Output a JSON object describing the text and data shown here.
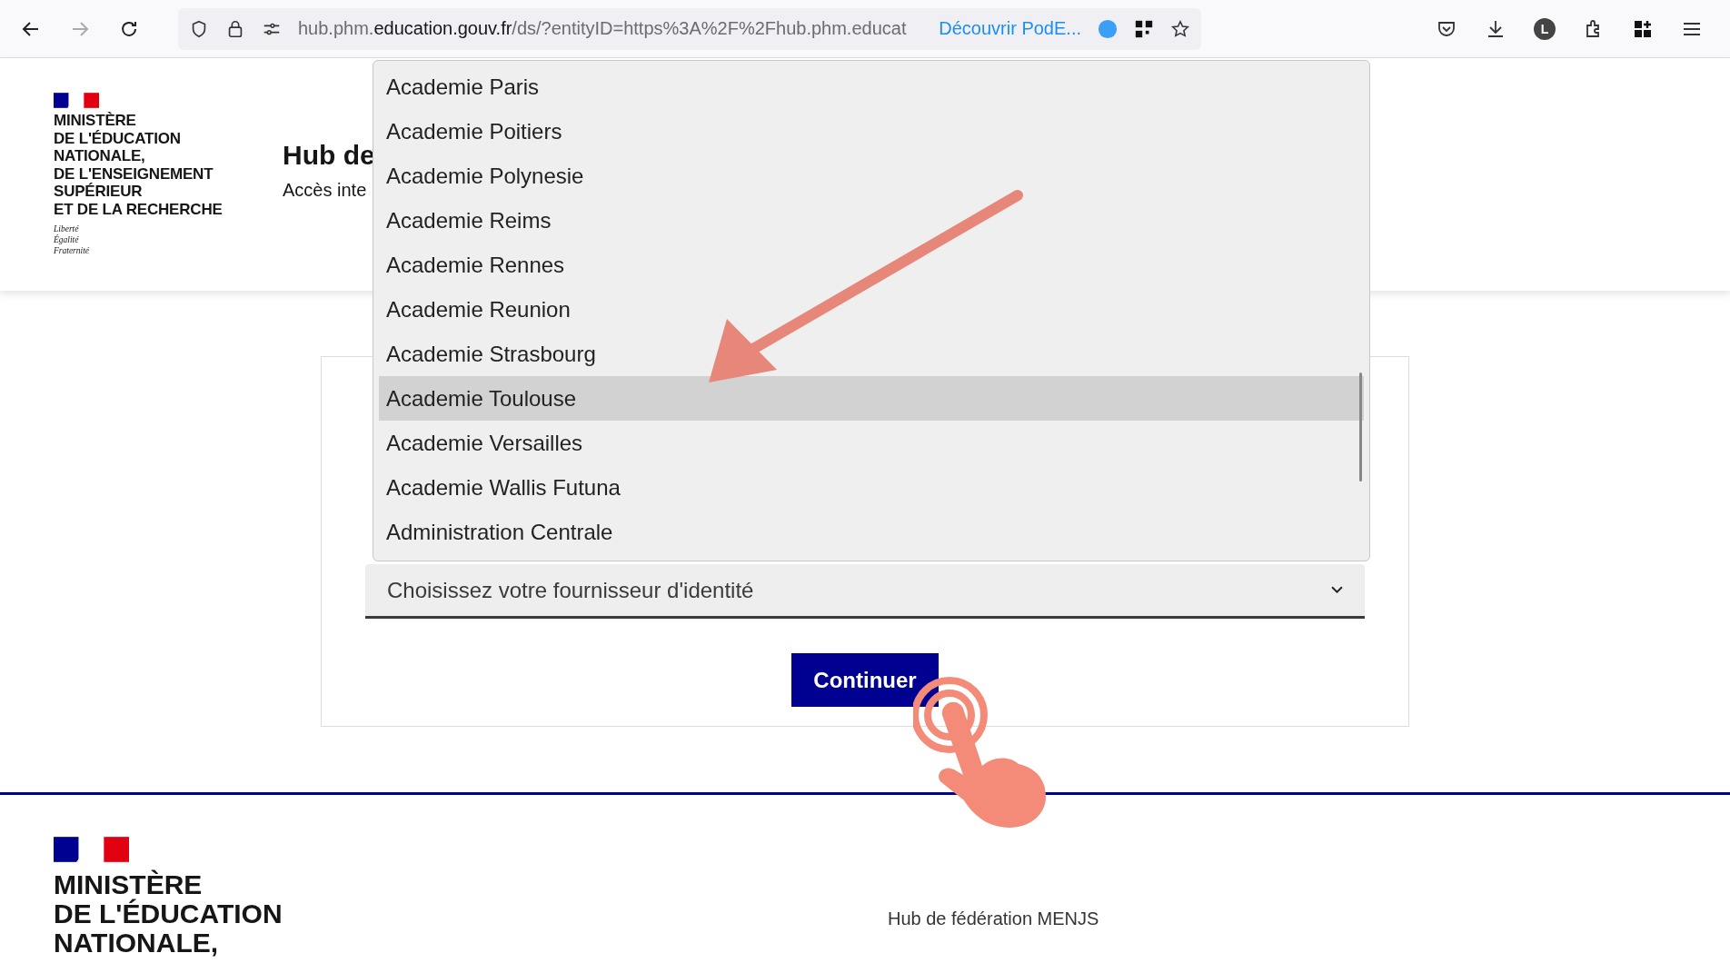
{
  "browser": {
    "url_host_prefix": "hub.phm.",
    "url_domain": "education.gouv.fr",
    "url_path": "/ds/?entityID=https%3A%2F%2Fhub.phm.educat",
    "promo": "Découvrir PodE...",
    "profile_initial": "L"
  },
  "header": {
    "logo_lines": [
      "MINISTÈRE",
      "DE L'ÉDUCATION",
      "NATIONALE,",
      "DE L'ENSEIGNEMENT",
      "SUPÉRIEUR",
      "ET DE LA RECHERCHE"
    ],
    "motto": [
      "Liberté",
      "Égalité",
      "Fraternité"
    ],
    "title": "Hub de",
    "subtitle": "Accès inte"
  },
  "dropdown": {
    "items": [
      {
        "label": "Academie Paris",
        "selected": false
      },
      {
        "label": "Academie Poitiers",
        "selected": false
      },
      {
        "label": "Academie Polynesie",
        "selected": false
      },
      {
        "label": "Academie Reims",
        "selected": false
      },
      {
        "label": "Academie Rennes",
        "selected": false
      },
      {
        "label": "Academie Reunion",
        "selected": false
      },
      {
        "label": "Academie Strasbourg",
        "selected": false
      },
      {
        "label": "Academie Toulouse",
        "selected": true
      },
      {
        "label": "Academie Versailles",
        "selected": false
      },
      {
        "label": "Academie Wallis Futuna",
        "selected": false
      },
      {
        "label": "Administration Centrale",
        "selected": false
      }
    ]
  },
  "select": {
    "placeholder": "Choisissez votre fournisseur d'identité"
  },
  "continue_button": "Continuer",
  "footer": {
    "logo_lines": [
      "MINISTÈRE",
      "DE L'ÉDUCATION",
      "NATIONALE,"
    ],
    "text": "Hub de fédération MENJS"
  }
}
